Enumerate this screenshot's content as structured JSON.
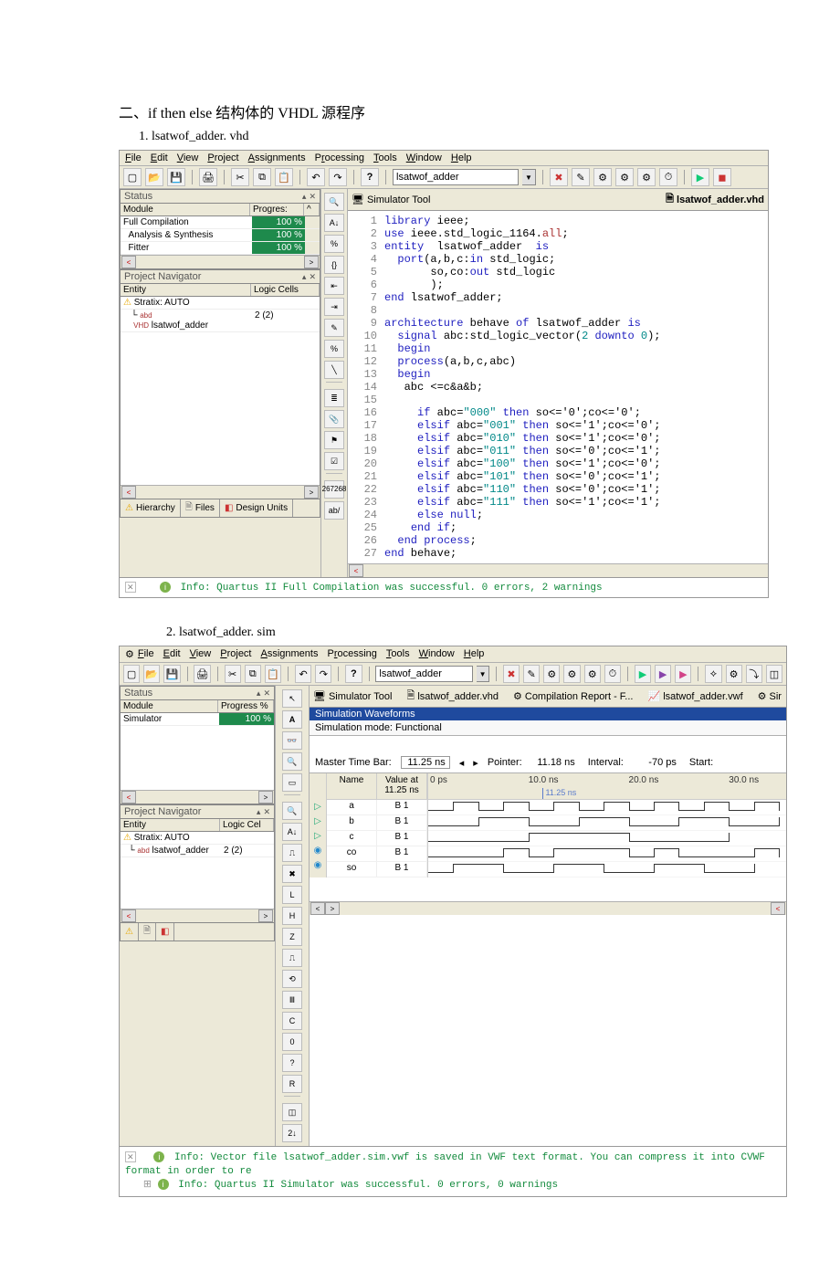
{
  "doc": {
    "heading1": "二、if  then  else 结构体的 VHDL 源程序",
    "list_prefix1": "1.",
    "file1": "lsatwof_adder. vhd",
    "list_prefix2": "2.",
    "file2": "lsatwof_adder. sim"
  },
  "menu": {
    "file": "File",
    "edit": "Edit",
    "view": "View",
    "project": "Project",
    "assignments": "Assignments",
    "processing": "Processing",
    "tools": "Tools",
    "window": "Window",
    "help": "Help"
  },
  "toolbar": {
    "project_name": "lsatwof_adder"
  },
  "ss1": {
    "status_title": "Status",
    "status_cols": {
      "module": "Module",
      "progress": "Progres:"
    },
    "status_rows": [
      {
        "name": "Full Compilation",
        "progress": "100 %"
      },
      {
        "name": "Analysis & Synthesis",
        "progress": "100 %"
      },
      {
        "name": "Fitter",
        "progress": "100 %"
      }
    ],
    "projnav_title": "Project Navigator",
    "projnav_cols": {
      "entity": "Entity",
      "logic": "Logic Cells"
    },
    "projnav_rows": [
      {
        "entity": "Stratix: AUTO",
        "logic": ""
      },
      {
        "entity": "lsatwof_adder",
        "logic": "2 (2)"
      }
    ],
    "bottom_tabs": {
      "hierarchy": "Hierarchy",
      "files": "Files",
      "design": "Design Units"
    },
    "editor_tabs": {
      "sim": "Simulator Tool",
      "vhd": "lsatwof_adder.vhd"
    },
    "palette": {
      "n267": "267",
      "n268": "268",
      "ab": "ab/"
    },
    "code_lines": [
      [
        1,
        [
          [
            "kw-blue",
            "library"
          ],
          [
            "",
            " ieee;"
          ]
        ]
      ],
      [
        2,
        [
          [
            "kw-blue",
            "use"
          ],
          [
            "",
            " ieee.std_logic_1164."
          ],
          [
            "kw-red",
            "all"
          ],
          [
            "",
            ";"
          ]
        ]
      ],
      [
        3,
        [
          [
            "kw-blue",
            "entity"
          ],
          [
            "",
            "  lsatwof_adder  "
          ],
          [
            "kw-blue",
            "is"
          ]
        ]
      ],
      [
        4,
        [
          [
            "",
            "  "
          ],
          [
            "kw-blue",
            "port"
          ],
          [
            "",
            "(a,b,c:"
          ],
          [
            "kw-blue",
            "in"
          ],
          [
            "",
            " std_logic;"
          ]
        ]
      ],
      [
        5,
        [
          [
            "",
            "       so,co:"
          ],
          [
            "kw-blue",
            "out"
          ],
          [
            "",
            " std_logic"
          ]
        ]
      ],
      [
        6,
        [
          [
            "",
            "       );"
          ]
        ]
      ],
      [
        7,
        [
          [
            "kw-blue",
            "end"
          ],
          [
            "",
            " lsatwof_adder;"
          ]
        ]
      ],
      [
        8,
        [
          [
            "",
            ""
          ]
        ]
      ],
      [
        9,
        [
          [
            "kw-blue",
            "architecture"
          ],
          [
            "",
            " behave "
          ],
          [
            "kw-blue",
            "of"
          ],
          [
            "",
            " lsatwof_adder "
          ],
          [
            "kw-blue",
            "is"
          ]
        ]
      ],
      [
        10,
        [
          [
            "",
            "  "
          ],
          [
            "kw-blue",
            "signal"
          ],
          [
            "",
            " abc:std_logic_vector("
          ],
          [
            "kw-teal",
            "2"
          ],
          [
            "",
            " "
          ],
          [
            "kw-blue",
            "downto"
          ],
          [
            "",
            " "
          ],
          [
            "kw-teal",
            "0"
          ],
          [
            "",
            ");"
          ]
        ]
      ],
      [
        11,
        [
          [
            "",
            "  "
          ],
          [
            "kw-blue",
            "begin"
          ]
        ]
      ],
      [
        12,
        [
          [
            "",
            "  "
          ],
          [
            "kw-blue",
            "process"
          ],
          [
            "",
            "(a,b,c,abc)"
          ]
        ]
      ],
      [
        13,
        [
          [
            "",
            "  "
          ],
          [
            "kw-blue",
            "begin"
          ]
        ]
      ],
      [
        14,
        [
          [
            "",
            "   abc <=c&a&b;"
          ]
        ]
      ],
      [
        15,
        [
          [
            "",
            ""
          ]
        ]
      ],
      [
        16,
        [
          [
            "",
            "     "
          ],
          [
            "kw-blue",
            "if"
          ],
          [
            "",
            " abc="
          ],
          [
            "kw-teal",
            "\"000\""
          ],
          [
            "",
            " "
          ],
          [
            "kw-blue",
            "then"
          ],
          [
            "",
            " so<='0';co<='0';"
          ]
        ]
      ],
      [
        17,
        [
          [
            "",
            "     "
          ],
          [
            "kw-blue",
            "elsif"
          ],
          [
            "",
            " abc="
          ],
          [
            "kw-teal",
            "\"001\""
          ],
          [
            "",
            " "
          ],
          [
            "kw-blue",
            "then"
          ],
          [
            "",
            " so<='1';co<='0';"
          ]
        ]
      ],
      [
        18,
        [
          [
            "",
            "     "
          ],
          [
            "kw-blue",
            "elsif"
          ],
          [
            "",
            " abc="
          ],
          [
            "kw-teal",
            "\"010\""
          ],
          [
            "",
            " "
          ],
          [
            "kw-blue",
            "then"
          ],
          [
            "",
            " so<='1';co<='0';"
          ]
        ]
      ],
      [
        19,
        [
          [
            "",
            "     "
          ],
          [
            "kw-blue",
            "elsif"
          ],
          [
            "",
            " abc="
          ],
          [
            "kw-teal",
            "\"011\""
          ],
          [
            "",
            " "
          ],
          [
            "kw-blue",
            "then"
          ],
          [
            "",
            " so<='0';co<='1';"
          ]
        ]
      ],
      [
        20,
        [
          [
            "",
            "     "
          ],
          [
            "kw-blue",
            "elsif"
          ],
          [
            "",
            " abc="
          ],
          [
            "kw-teal",
            "\"100\""
          ],
          [
            "",
            " "
          ],
          [
            "kw-blue",
            "then"
          ],
          [
            "",
            " so<='1';co<='0';"
          ]
        ]
      ],
      [
        21,
        [
          [
            "",
            "     "
          ],
          [
            "kw-blue",
            "elsif"
          ],
          [
            "",
            " abc="
          ],
          [
            "kw-teal",
            "\"101\""
          ],
          [
            "",
            " "
          ],
          [
            "kw-blue",
            "then"
          ],
          [
            "",
            " so<='0';co<='1';"
          ]
        ]
      ],
      [
        22,
        [
          [
            "",
            "     "
          ],
          [
            "kw-blue",
            "elsif"
          ],
          [
            "",
            " abc="
          ],
          [
            "kw-teal",
            "\"110\""
          ],
          [
            "",
            " "
          ],
          [
            "kw-blue",
            "then"
          ],
          [
            "",
            " so<='0';co<='1';"
          ]
        ]
      ],
      [
        23,
        [
          [
            "",
            "     "
          ],
          [
            "kw-blue",
            "elsif"
          ],
          [
            "",
            " abc="
          ],
          [
            "kw-teal",
            "\"111\""
          ],
          [
            "",
            " "
          ],
          [
            "kw-blue",
            "then"
          ],
          [
            "",
            " so<='1';co<='1';"
          ]
        ]
      ],
      [
        24,
        [
          [
            "",
            "     "
          ],
          [
            "kw-blue",
            "else"
          ],
          [
            "",
            " "
          ],
          [
            "kw-blue",
            "null"
          ],
          [
            "",
            ";"
          ]
        ]
      ],
      [
        25,
        [
          [
            "",
            "    "
          ],
          [
            "kw-blue",
            "end"
          ],
          [
            "",
            " "
          ],
          [
            "kw-blue",
            "if"
          ],
          [
            "",
            ";"
          ]
        ]
      ],
      [
        26,
        [
          [
            "",
            "  "
          ],
          [
            "kw-blue",
            "end"
          ],
          [
            "",
            " "
          ],
          [
            "kw-blue",
            "process"
          ],
          [
            "",
            ";"
          ]
        ]
      ],
      [
        27,
        [
          [
            "kw-blue",
            "end"
          ],
          [
            "",
            " behave;"
          ]
        ]
      ]
    ],
    "message": "Info: Quartus II Full Compilation was successful. 0 errors, 2 warnings"
  },
  "ss2": {
    "status_title": "Status",
    "status_cols": {
      "module": "Module",
      "progress": "Progress %"
    },
    "status_rows": [
      {
        "name": "Simulator",
        "progress": "100 %"
      }
    ],
    "projnav_title": "Project Navigator",
    "projnav_cols": {
      "entity": "Entity",
      "logic": "Logic Cel"
    },
    "projnav_rows": [
      {
        "entity": "Stratix: AUTO",
        "logic": ""
      },
      {
        "entity": "lsatwof_adder",
        "logic": "2 (2)"
      }
    ],
    "top_tabs": {
      "sim": "Simulator Tool",
      "vhd": "lsatwof_adder.vhd",
      "rpt": "Compilation Report - F...",
      "vwf": "lsatwof_adder.vwf",
      "sir": "Sir"
    },
    "blue_bar": "Simulation Waveforms",
    "sim_mode": "Simulation mode: Functional",
    "timebar": {
      "mtb_label": "Master Time Bar:",
      "mtb_val": "11.25 ns",
      "ptr_label": "Pointer:",
      "ptr_val": "11.18 ns",
      "int_label": "Interval:",
      "int_val": "-70 ps",
      "start_label": "Start:"
    },
    "wave_hdr": {
      "name": "Name",
      "value": "Value at\n11.25 ns",
      "ticks": [
        "0 ps",
        "10.0 ns",
        "20.0 ns",
        "30.0 ns"
      ],
      "marker": "11.25 ns"
    },
    "wave_rows": [
      {
        "type": "in",
        "name": "a",
        "val": "B 1"
      },
      {
        "type": "in",
        "name": "b",
        "val": "B 1"
      },
      {
        "type": "in",
        "name": "c",
        "val": "B 1"
      },
      {
        "type": "out",
        "name": "co",
        "val": "B 1"
      },
      {
        "type": "out",
        "name": "so",
        "val": "B 1"
      }
    ],
    "messages": [
      "Info: Vector file lsatwof_adder.sim.vwf is saved in VWF text format. You can compress it into CVWF format in order to re",
      "Info: Quartus II Simulator was successful. 0 errors, 0 warnings"
    ]
  }
}
